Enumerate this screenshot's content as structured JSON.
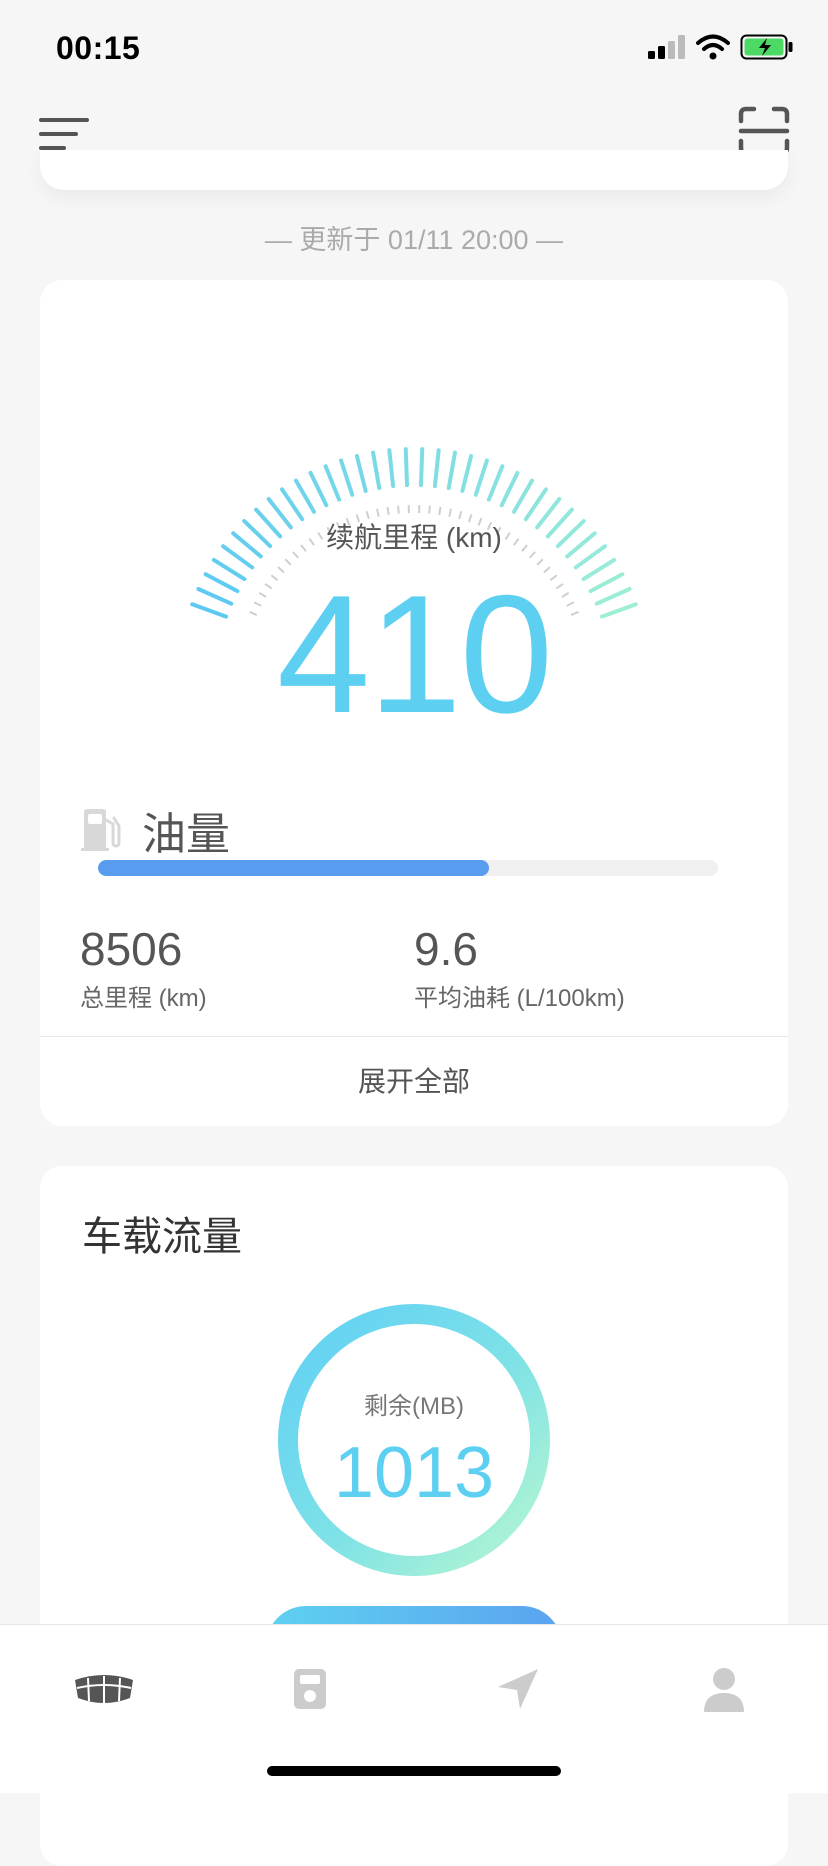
{
  "status_bar": {
    "time": "00:15"
  },
  "update": {
    "text": "— 更新于 01/11 20:00 —"
  },
  "range": {
    "label": "续航里程 (km)",
    "value": "410"
  },
  "fuel": {
    "label": "油量",
    "level_fraction": 0.63
  },
  "stats": {
    "total_mileage": {
      "value": "8506",
      "label": "总里程 (km)"
    },
    "avg_fuel": {
      "value": "9.6",
      "label": "平均油耗 (L/100km)"
    }
  },
  "expand": {
    "label": "展开全部"
  },
  "traffic": {
    "title": "车载流量",
    "remaining_label": "剩余(MB)",
    "remaining_value": "1013"
  },
  "tabs": [
    {
      "icon": "car-logo-icon",
      "active": true
    },
    {
      "icon": "fuel-card-icon",
      "active": false
    },
    {
      "icon": "navigation-icon",
      "active": false
    },
    {
      "icon": "user-icon",
      "active": false
    }
  ],
  "colors": {
    "accent": "#5dd0f2",
    "fuel_bar": "#589cf0",
    "ring_end": "#b8f7d0"
  }
}
